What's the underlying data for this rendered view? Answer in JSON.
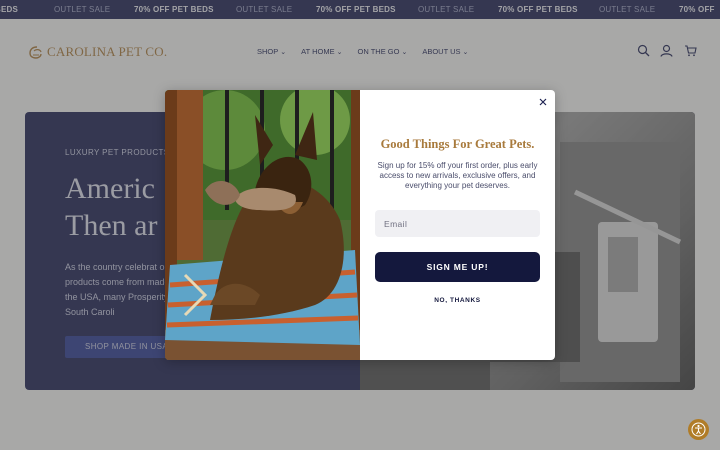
{
  "announcement": {
    "items": [
      {
        "text": "BEDS",
        "style": "bold"
      },
      {
        "text": "OUTLET SALE",
        "style": "light"
      },
      {
        "text": "70% OFF PET BEDS",
        "style": "bold"
      },
      {
        "text": "OUTLET SALE",
        "style": "light"
      },
      {
        "text": "70% OFF PET BEDS",
        "style": "bold"
      },
      {
        "text": "OUTLET SALE",
        "style": "light"
      },
      {
        "text": "70% OFF PET BEDS",
        "style": "bold"
      },
      {
        "text": "OUTLET SALE",
        "style": "light"
      },
      {
        "text": "70% OFF",
        "style": "bold"
      }
    ]
  },
  "header": {
    "logo_text": "CAROLINA PET CO.",
    "nav": [
      {
        "label": "SHOP"
      },
      {
        "label": "AT HOME"
      },
      {
        "label": "ON THE GO"
      },
      {
        "label": "ABOUT US"
      }
    ],
    "icons": [
      "search-icon",
      "account-icon",
      "cart-icon"
    ]
  },
  "hero": {
    "eyebrow": "LUXURY PET PRODUCTS",
    "title_line1": "Americ",
    "title_line2": "Then ar",
    "body": "As the country celebrat our products come from made in the USA, many Prosperity, South Caroli",
    "button_label": "SHOP MADE IN USA"
  },
  "modal": {
    "title": "Good Things For Great Pets.",
    "text": "Sign up for 15% off your first order, plus early access to new arrivals, exclusive offers, and everything your pet deserves.",
    "email_placeholder": "Email",
    "signup_label": "SIGN ME UP!",
    "no_thanks_label": "NO, THANKS"
  },
  "colors": {
    "navy": "#1f2453",
    "gold": "#a87a3c",
    "button_dark": "#14183d",
    "a11y": "#b07c27"
  }
}
